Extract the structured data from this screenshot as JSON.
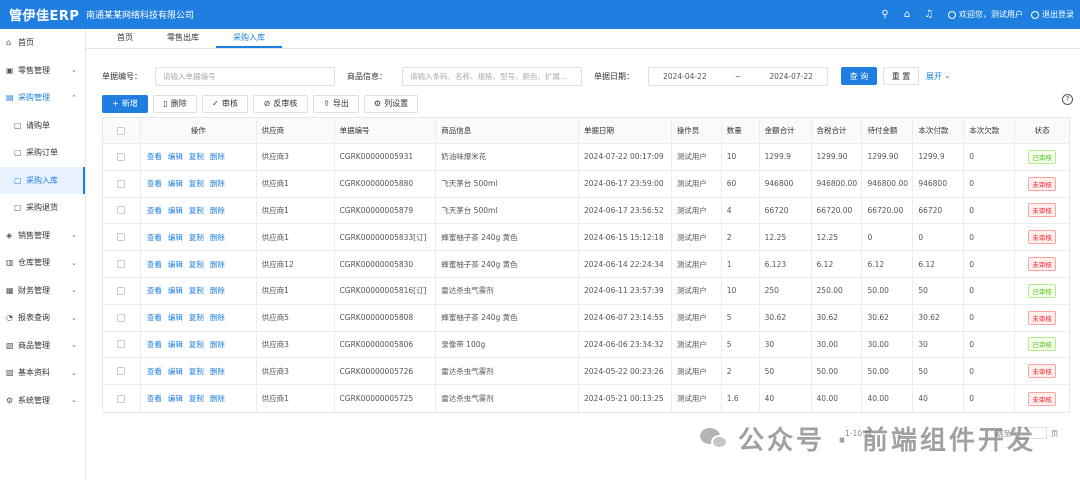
{
  "topbar": {
    "logo": "管伊佳ERP",
    "company": "南通某某网络科技有限公司",
    "welcome": "欢迎您，测试用户",
    "logout": "退出登录"
  },
  "sidebar": {
    "items": [
      {
        "label": "首页",
        "icon": "home-icon",
        "glyph": "⌂"
      },
      {
        "label": "零售管理",
        "icon": "retail-icon",
        "glyph": "▣",
        "chevron": "⌄"
      },
      {
        "label": "采购管理",
        "icon": "purchase-icon",
        "glyph": "▤",
        "chevron": "⌃",
        "open": true,
        "children": [
          {
            "label": "请购单",
            "icon": "doc-icon",
            "glyph": "▢"
          },
          {
            "label": "采购订单",
            "icon": "doc-icon",
            "glyph": "▢"
          },
          {
            "label": "采购入库",
            "icon": "doc-icon",
            "glyph": "▢",
            "active": true
          },
          {
            "label": "采购退货",
            "icon": "doc-icon",
            "glyph": "▢"
          }
        ]
      },
      {
        "label": "销售管理",
        "icon": "sales-icon",
        "glyph": "◈",
        "chevron": "⌄"
      },
      {
        "label": "仓库管理",
        "icon": "warehouse-icon",
        "glyph": "▥",
        "chevron": "⌄"
      },
      {
        "label": "财务管理",
        "icon": "finance-icon",
        "glyph": "▦",
        "chevron": "⌄"
      },
      {
        "label": "报表查询",
        "icon": "report-icon",
        "glyph": "◔",
        "chevron": "⌄"
      },
      {
        "label": "商品管理",
        "icon": "goods-icon",
        "glyph": "▧",
        "chevron": "⌄"
      },
      {
        "label": "基本资料",
        "icon": "basic-icon",
        "glyph": "▨",
        "chevron": "⌄"
      },
      {
        "label": "系统管理",
        "icon": "system-icon",
        "glyph": "⚙",
        "chevron": "⌄"
      }
    ]
  },
  "tabs": [
    {
      "label": "首页"
    },
    {
      "label": "零售出库"
    },
    {
      "label": "采购入库",
      "active": true
    }
  ],
  "search": {
    "bill_no_label": "单据编号：",
    "bill_no_placeholder": "请输入单据编号",
    "goods_label": "商品信息：",
    "goods_placeholder": "请输入条码、名称、规格、型号、颜色、扩展...",
    "date_label": "单据日期：",
    "date_start": "2024-04-22",
    "date_sep": "~",
    "date_end": "2024-07-22",
    "query": "查 询",
    "reset": "重 置",
    "expand": "展开"
  },
  "toolbar": {
    "add": "新增",
    "delete": "删除",
    "audit": "审核",
    "unaudit": "反审核",
    "export": "导出",
    "columns": "列设置"
  },
  "table": {
    "headers": [
      "",
      "操作",
      "供应商",
      "单据编号",
      "商品信息",
      "单据日期",
      "操作员",
      "数量",
      "金额合计",
      "含税合计",
      "待付金额",
      "本次付款",
      "本次欠款",
      "状态"
    ],
    "ops": [
      "查看",
      "编辑",
      "复制",
      "删除"
    ],
    "rows": [
      {
        "supplier": "供应商3",
        "no": "CGRK00000005931",
        "goods": "奶油味爆米花",
        "date": "2024-07-22 00:17:09",
        "operator": "测试用户",
        "qty": "10",
        "amount": "1299.9",
        "tax": "1299.90",
        "due": "1299.90",
        "paid": "1299.9",
        "owed": "0",
        "status": "已审核",
        "ok": true
      },
      {
        "supplier": "供应商1",
        "no": "CGRK00000005880",
        "goods": "飞天茅台 500ml",
        "date": "2024-06-17 23:59:00",
        "operator": "测试用户",
        "qty": "60",
        "amount": "946800",
        "tax": "946800.00",
        "due": "946800.00",
        "paid": "946800",
        "owed": "0",
        "status": "未审核",
        "ok": false
      },
      {
        "supplier": "供应商1",
        "no": "CGRK00000005879",
        "goods": "飞天茅台 500ml",
        "date": "2024-06-17 23:56:52",
        "operator": "测试用户",
        "qty": "4",
        "amount": "66720",
        "tax": "66720.00",
        "due": "66720.00",
        "paid": "66720",
        "owed": "0",
        "status": "未审核",
        "ok": false
      },
      {
        "supplier": "供应商1",
        "no": "CGRK00000005833[订]",
        "goods": "蜂蜜柚子茶 240g 黄色",
        "date": "2024-06-15 15:12:18",
        "operator": "测试用户",
        "qty": "2",
        "amount": "12.25",
        "tax": "12.25",
        "due": "0",
        "paid": "0",
        "owed": "0",
        "status": "未审核",
        "ok": false
      },
      {
        "supplier": "供应商12",
        "no": "CGRK00000005830",
        "goods": "蜂蜜柚子茶 240g 黄色",
        "date": "2024-06-14 22:24:34",
        "operator": "测试用户",
        "qty": "1",
        "amount": "6.123",
        "tax": "6.12",
        "due": "6.12",
        "paid": "6.12",
        "owed": "0",
        "status": "未审核",
        "ok": false
      },
      {
        "supplier": "供应商1",
        "no": "CGRK00000005816[订]",
        "goods": "雷达杀虫气雾剂",
        "date": "2024-06-11 23:57:39",
        "operator": "测试用户",
        "qty": "10",
        "amount": "250",
        "tax": "250.00",
        "due": "50.00",
        "paid": "50",
        "owed": "0",
        "status": "已审核",
        "ok": true
      },
      {
        "supplier": "供应商5",
        "no": "CGRK00000005808",
        "goods": "蜂蜜柚子茶 240g 黄色",
        "date": "2024-06-07 23:14:55",
        "operator": "测试用户",
        "qty": "5",
        "amount": "30.62",
        "tax": "30.62",
        "due": "30.62",
        "paid": "30.62",
        "owed": "0",
        "status": "未审核",
        "ok": false
      },
      {
        "supplier": "供应商3",
        "no": "CGRK00000005806",
        "goods": "录像带 100g",
        "date": "2024-06-06 23:34:32",
        "operator": "测试用户",
        "qty": "5",
        "amount": "30",
        "tax": "30.00",
        "due": "30.00",
        "paid": "30",
        "owed": "0",
        "status": "已审核",
        "ok": true
      },
      {
        "supplier": "供应商3",
        "no": "CGRK00000005726",
        "goods": "雷达杀虫气雾剂",
        "date": "2024-05-22 00:23:26",
        "operator": "测试用户",
        "qty": "2",
        "amount": "50",
        "tax": "50.00",
        "due": "50.00",
        "paid": "50",
        "owed": "0",
        "status": "未审核",
        "ok": false
      },
      {
        "supplier": "供应商1",
        "no": "CGRK00000005725",
        "goods": "雷达杀虫气雾剂",
        "date": "2024-05-21 00:13:25",
        "operator": "测试用户",
        "qty": "1.6",
        "amount": "40",
        "tax": "40.00",
        "due": "40.00",
        "paid": "40",
        "owed": "0",
        "status": "未审核",
        "ok": false
      }
    ]
  },
  "pager": {
    "summary": "1-10 共",
    "goto": "跳至",
    "page_unit": "页"
  },
  "watermark": {
    "text": "公众号 · 前端组件开发"
  },
  "colors": {
    "primary": "#1e7fe0",
    "approved": "#52c41a",
    "unapproved": "#f5222d"
  }
}
